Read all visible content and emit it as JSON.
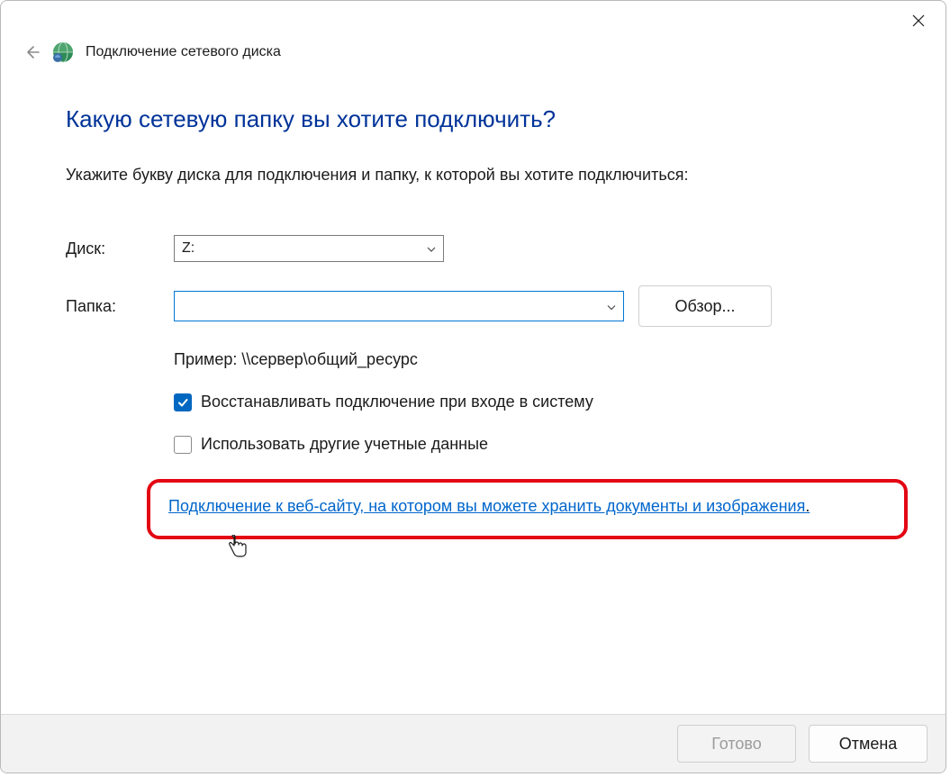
{
  "header": {
    "title": "Подключение сетевого диска"
  },
  "main": {
    "question": "Какую сетевую папку вы хотите подключить?",
    "instruction": "Укажите букву диска для подключения и папку, к которой вы хотите подключиться:"
  },
  "form": {
    "drive_label": "Диск:",
    "drive_value": "Z:",
    "folder_label": "Папка:",
    "folder_value": "",
    "browse_label": "Обзор...",
    "example": "Пример: \\\\сервер\\общий_ресурс",
    "checkbox_reconnect": "Восстанавливать подключение при входе в систему",
    "checkbox_reconnect_checked": true,
    "checkbox_credentials": "Использовать другие учетные данные",
    "checkbox_credentials_checked": false,
    "link_text": "Подключение к веб-сайту, на котором вы можете хранить документы и изображения"
  },
  "footer": {
    "finish_label": "Готово",
    "cancel_label": "Отмена"
  }
}
